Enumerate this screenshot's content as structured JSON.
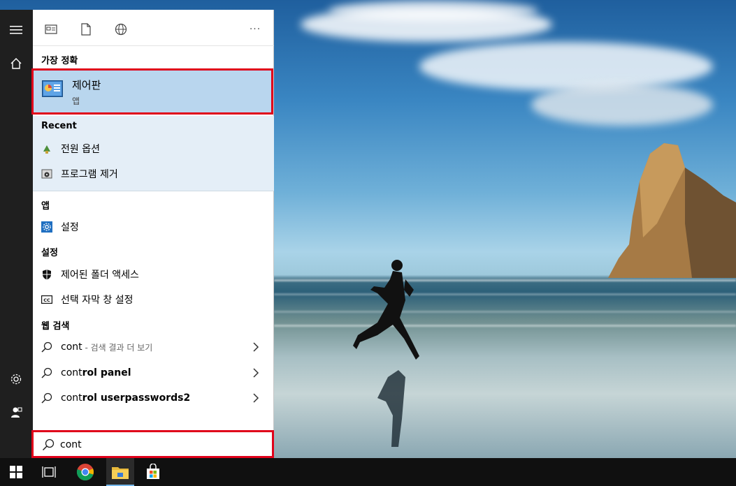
{
  "start_menu": {
    "rail": {
      "hamburger_icon": "hamburger-icon",
      "home_icon": "home-icon",
      "settings_icon": "gear-icon",
      "user_icon": "user-icon"
    },
    "filter_tabs": [
      {
        "icon": "document-window-icon"
      },
      {
        "icon": "file-icon"
      },
      {
        "icon": "globe-icon"
      }
    ],
    "more_label": "···",
    "best_match": {
      "heading": "가장 정확",
      "title": "제어판",
      "subtitle": "앱"
    },
    "recent": {
      "heading": "Recent",
      "items": [
        {
          "label": "전원 옵션",
          "icon": "power-options-icon"
        },
        {
          "label": "프로그램 제거",
          "icon": "uninstall-program-icon"
        }
      ]
    },
    "apps": {
      "heading": "앱",
      "items": [
        {
          "label": "설정",
          "icon": "settings-gear-icon"
        }
      ]
    },
    "settings": {
      "heading": "설정",
      "items": [
        {
          "label": "제어된 폴더 액세스",
          "icon": "shield-icon"
        },
        {
          "label": "선택 자막 창 설정",
          "icon": "cc-icon"
        }
      ]
    },
    "web": {
      "heading": "웹 검색",
      "items": [
        {
          "typed": "cont",
          "suffix": " - 검색 결과 더 보기",
          "completion": ""
        },
        {
          "typed": "cont",
          "suffix": "",
          "completion": "rol panel"
        },
        {
          "typed": "cont",
          "suffix": "",
          "completion": "rol userpasswords2"
        }
      ]
    },
    "search": {
      "value": "cont"
    }
  },
  "taskbar": {
    "items": [
      {
        "icon": "windows-start-icon"
      },
      {
        "icon": "task-view-icon"
      },
      {
        "icon": "chrome-icon"
      },
      {
        "icon": "file-explorer-icon"
      },
      {
        "icon": "microsoft-store-icon"
      }
    ]
  },
  "colors": {
    "highlight_border": "#e0001a",
    "best_match_bg": "#b9d6ee",
    "recent_bg": "#e4eef7",
    "taskbar_bg": "#101010",
    "rail_bg": "#1f1f1f"
  }
}
